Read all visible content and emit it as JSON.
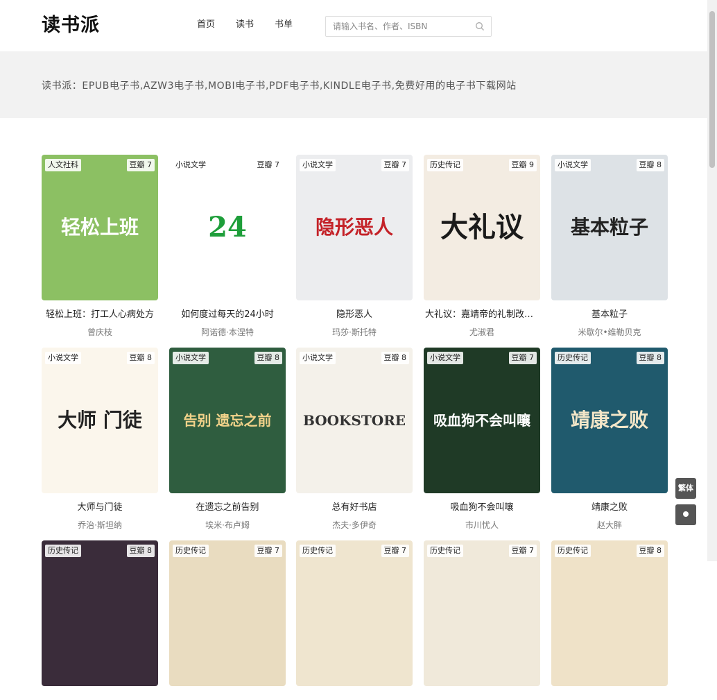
{
  "header": {
    "logo": "读书派",
    "nav": [
      "首页",
      "读书",
      "书单"
    ],
    "search_placeholder": "请输入书名、作者、ISBN"
  },
  "banner": {
    "text": "读书派：EPUB电子书,AZW3电子书,MOBI电子书,PDF电子书,KINDLE电子书,免费好用的电子书下载网站"
  },
  "books": [
    {
      "title": "轻松上班：打工人心病处方",
      "author": "曾庆枝",
      "category": "人文社科",
      "rating": "豆瓣 7",
      "cover_bg": "#8cc063",
      "cover_text": "轻松上班",
      "cover_color": "#ffffff"
    },
    {
      "title": "如何度过每天的24小时",
      "author": "阿诺德·本涅特",
      "category": "小说文学",
      "rating": "豆瓣 7",
      "cover_bg": "#ffffff",
      "cover_text": "24",
      "cover_color": "#1e9e3a"
    },
    {
      "title": "隐形恶人",
      "author": "玛莎·斯托特",
      "category": "小说文学",
      "rating": "豆瓣 7",
      "cover_bg": "#ecedef",
      "cover_text": "隐形恶人",
      "cover_color": "#c42228"
    },
    {
      "title": "大礼议：嘉靖帝的礼制改革与皇权重塑",
      "author": "尤淑君",
      "category": "历史传记",
      "rating": "豆瓣 9",
      "cover_bg": "#f3ece2",
      "cover_text": "大礼议",
      "cover_color": "#1a1a1a"
    },
    {
      "title": "基本粒子",
      "author": "米歇尔•维勒贝克",
      "category": "小说文学",
      "rating": "豆瓣 8",
      "cover_bg": "#dde2e6",
      "cover_text": "基本粒子",
      "cover_color": "#222222"
    },
    {
      "title": "大师与门徒",
      "author": "乔治·斯坦纳",
      "category": "小说文学",
      "rating": "豆瓣 8",
      "cover_bg": "#fbf6ec",
      "cover_text": "大师 门徒",
      "cover_color": "#222222"
    },
    {
      "title": "在遗忘之前告别",
      "author": "埃米·布卢姆",
      "category": "小说文学",
      "rating": "豆瓣 8",
      "cover_bg": "#2f5d3f",
      "cover_text": "告别 遗忘之前",
      "cover_color": "#f2d28a"
    },
    {
      "title": "总有好书店",
      "author": "杰夫·多伊奇",
      "category": "小说文学",
      "rating": "豆瓣 8",
      "cover_bg": "#f4f1ea",
      "cover_text": "BOOKSTORE",
      "cover_color": "#333333"
    },
    {
      "title": "吸血狗不会叫嚷",
      "author": "市川忧人",
      "category": "小说文学",
      "rating": "豆瓣 7",
      "cover_bg": "#1f3a26",
      "cover_text": "吸血狗不会叫嚷",
      "cover_color": "#ffffff"
    },
    {
      "title": "靖康之败",
      "author": "赵大胖",
      "category": "历史传记",
      "rating": "豆瓣 8",
      "cover_bg": "#205a6d",
      "cover_text": "靖康之败",
      "cover_color": "#f3e6c8"
    },
    {
      "title": "",
      "author": "",
      "category": "历史传记",
      "rating": "豆瓣 8",
      "cover_bg": "#3a2c3a",
      "cover_text": "",
      "cover_color": "#ffffff"
    },
    {
      "title": "",
      "author": "",
      "category": "历史传记",
      "rating": "豆瓣 7",
      "cover_bg": "#e9dcc0",
      "cover_text": "",
      "cover_color": "#333333"
    },
    {
      "title": "",
      "author": "",
      "category": "历史传记",
      "rating": "豆瓣 7",
      "cover_bg": "#efe5cf",
      "cover_text": "",
      "cover_color": "#333333"
    },
    {
      "title": "",
      "author": "",
      "category": "历史传记",
      "rating": "豆瓣 7",
      "cover_bg": "#f0e9da",
      "cover_text": "",
      "cover_color": "#333333"
    },
    {
      "title": "",
      "author": "",
      "category": "历史传记",
      "rating": "豆瓣 8",
      "cover_bg": "#efe2c8",
      "cover_text": "",
      "cover_color": "#333333"
    }
  ],
  "float_buttons": {
    "traditional": "繁体"
  }
}
